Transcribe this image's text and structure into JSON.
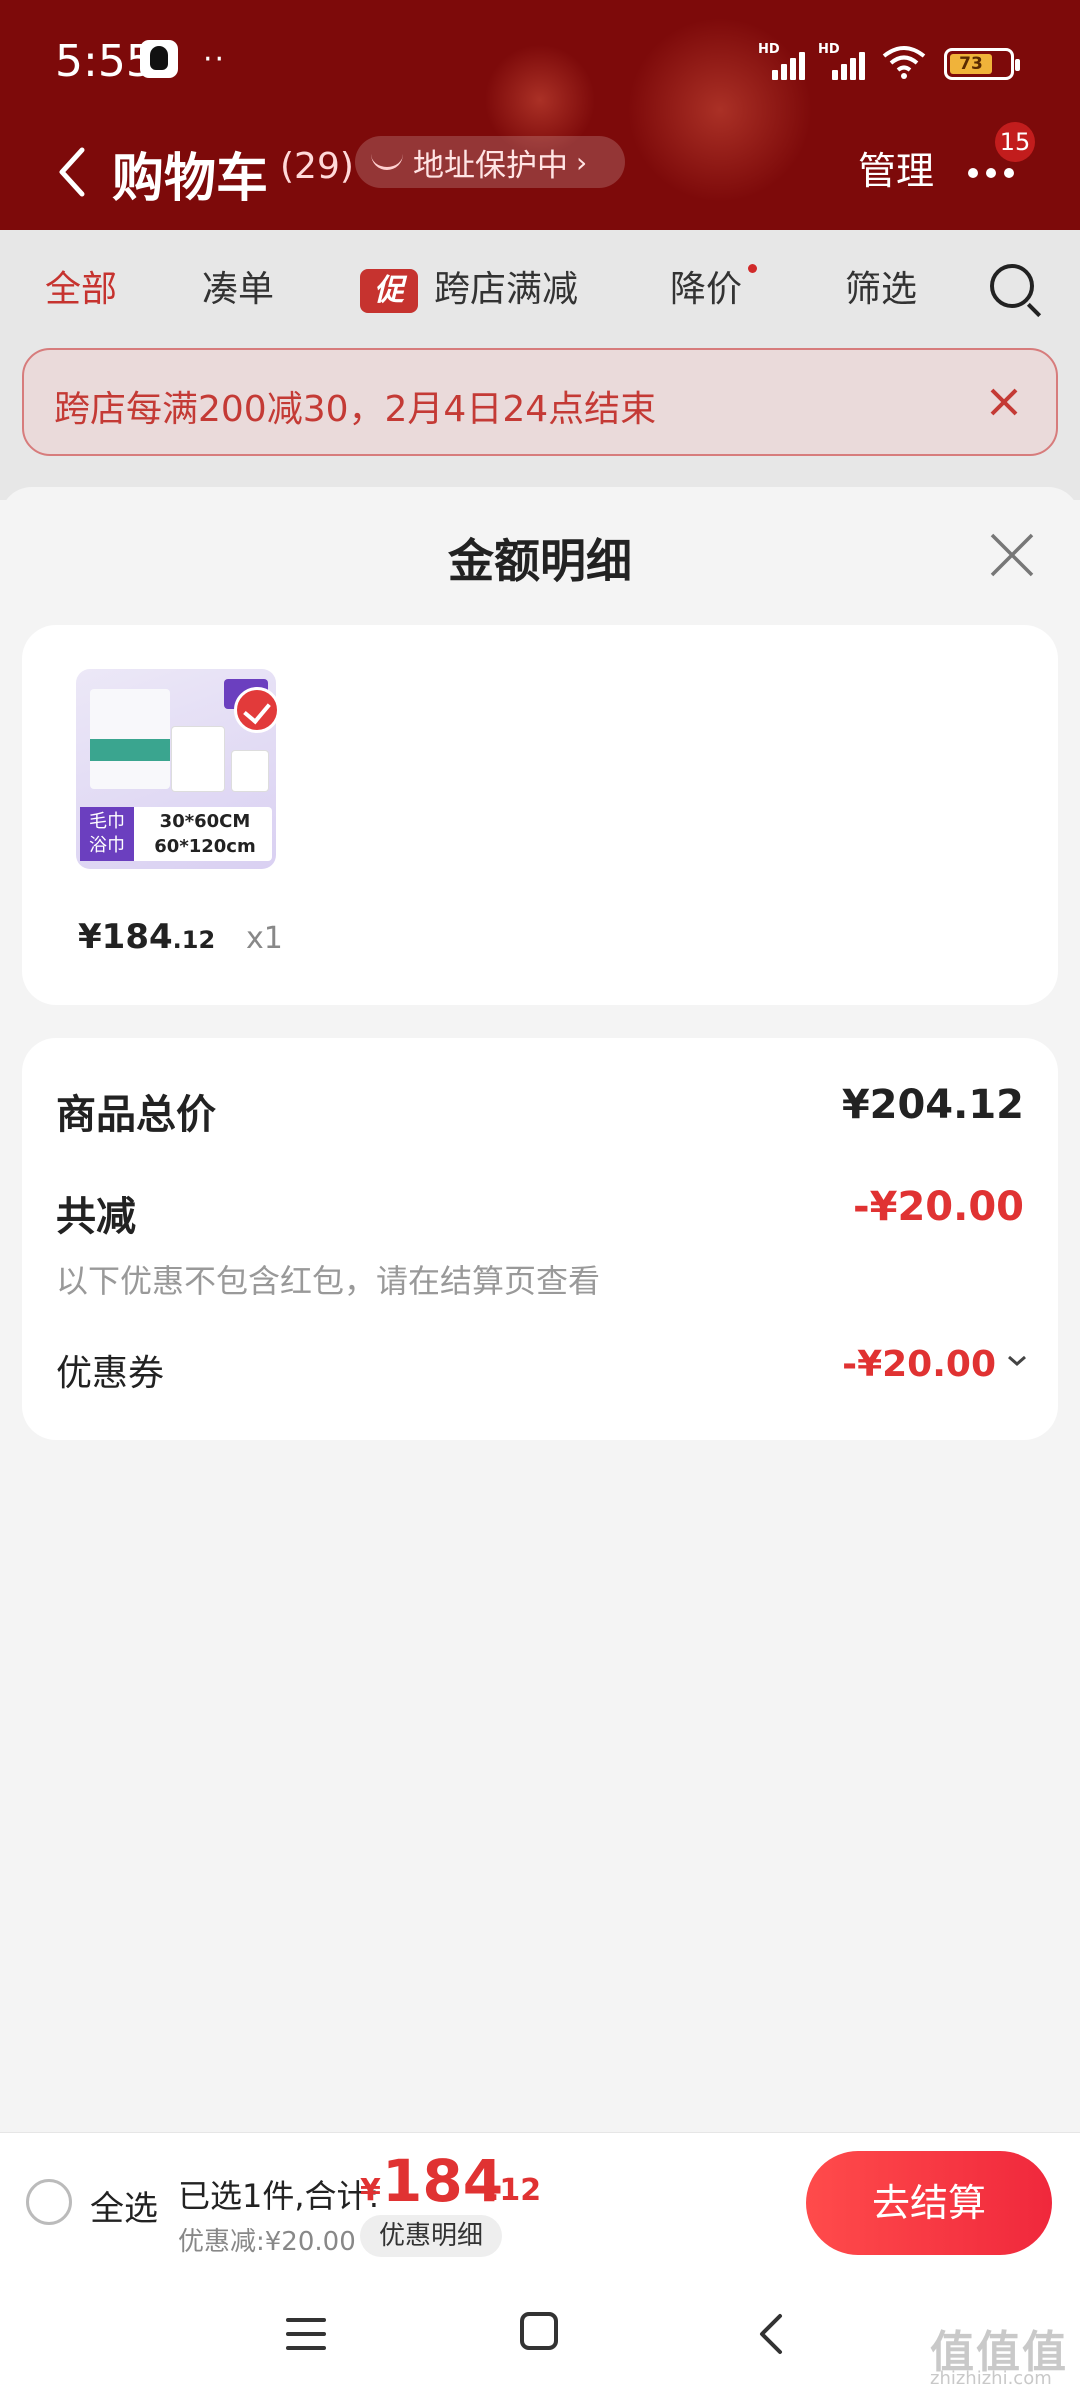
{
  "status_bar": {
    "time": "5:55",
    "dots": "··",
    "hd1": "HD",
    "hd2": "HD",
    "battery": "73"
  },
  "nav": {
    "title": "购物车",
    "count": "(29)",
    "address_protect": "地址保护中",
    "manage": "管理",
    "more_badge": "15"
  },
  "filter_tabs": {
    "all": "全部",
    "combine": "凑单",
    "promo_badge": "促",
    "cross_store": "跨店满减",
    "price_drop": "降价",
    "filter": "筛选"
  },
  "notice": {
    "text": "跨店每满200减30，2月4日24点结束"
  },
  "sheet": {
    "title": "金额明细",
    "item": {
      "label_cn_1": "毛巾",
      "label_cn_2": "浴巾",
      "size_1": "30*60CM",
      "size_2": "60*120cm",
      "price_main": "¥184",
      "price_cents": ".12",
      "qty": "x1"
    },
    "summary": {
      "total_label": "商品总价",
      "total_value": "¥204.12",
      "reduce_label": "共减",
      "reduce_value": "-¥20.00",
      "note": "以下优惠不包含红包，请在结算页查看",
      "coupon_label": "优惠券",
      "coupon_value": "-¥20.00"
    }
  },
  "bottom_bar": {
    "select_all": "全选",
    "selected": "已选1件,合计:",
    "currency": "¥",
    "total_main": "184",
    "total_cents": ".12",
    "discount": "优惠减:¥20.00",
    "detail_button": "优惠明细",
    "checkout": "去结算"
  },
  "watermark": {
    "text": "值值值",
    "sub": "zhizhizhi.com"
  },
  "colors": {
    "header_red": "#7d0a0a",
    "accent_red": "#e03232",
    "checkout_red": "#f0283c"
  }
}
